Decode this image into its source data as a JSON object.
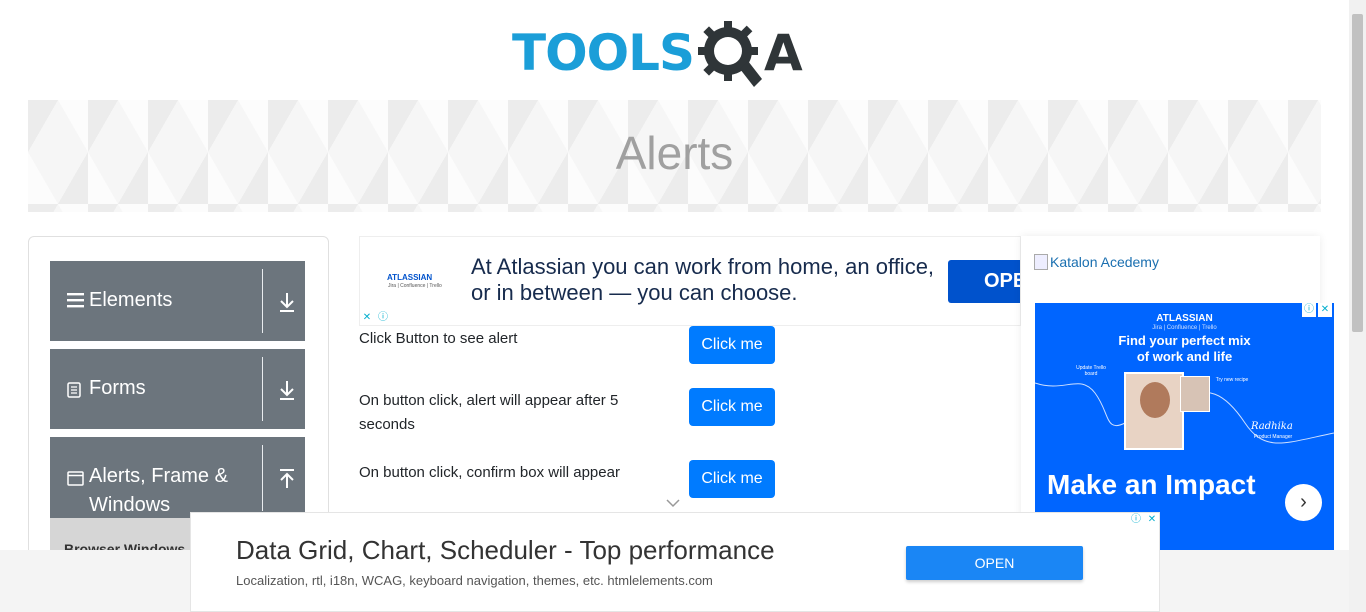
{
  "header": {
    "logo_main": "TOOLS",
    "logo_q": "Q",
    "logo_a": "A"
  },
  "banner": {
    "title": "Alerts"
  },
  "sidebar": {
    "groups": [
      {
        "label": "Elements",
        "icon": "hamburger-icon",
        "state": "collapsed"
      },
      {
        "label": "Forms",
        "icon": "document-icon",
        "state": "collapsed"
      },
      {
        "label": "Alerts, Frame &",
        "label2": "Windows",
        "icon": "window-icon",
        "state": "expanded"
      }
    ],
    "submenu_item": "Browser Windows"
  },
  "top_ad": {
    "brand": "ATLASSIAN",
    "brand_sub": "Jira | Confluence | Trello",
    "text": "At Atlassian you can work from home, an office, or in between — you can choose.",
    "button": "OPEN"
  },
  "rows": [
    {
      "text": "Click Button to see alert",
      "button": "Click me"
    },
    {
      "text": "On button click, alert will appear after 5 seconds",
      "button": "Click me"
    },
    {
      "text": "On button click, confirm box will appear",
      "button": "Click me"
    }
  ],
  "right_ad": {
    "image_alt": "Katalon Acedemy",
    "brand": "ATLASSIAN",
    "brand_sub": "Jira | Confluence | Trello",
    "title_line1": "Find your perfect mix",
    "title_line2": "of work and life",
    "label_update": "Update Trello board",
    "label_recipe": "Try new recipe",
    "signature": "Radhika",
    "role": "Product Manager",
    "headline": "Make an Impact"
  },
  "bottom_ad": {
    "title": "Data Grid, Chart, Scheduler - Top performance",
    "subtitle": "Localization, rtl, i18n, WCAG, keyboard navigation, themes, etc. htmlelements.com",
    "button": "OPEN"
  },
  "colors": {
    "accent": "#007bff",
    "sidebar_group": "#6c757d",
    "logo_blue": "#1b9ed8",
    "logo_dark": "#2f3538",
    "atlassian_blue": "#0065ff"
  }
}
